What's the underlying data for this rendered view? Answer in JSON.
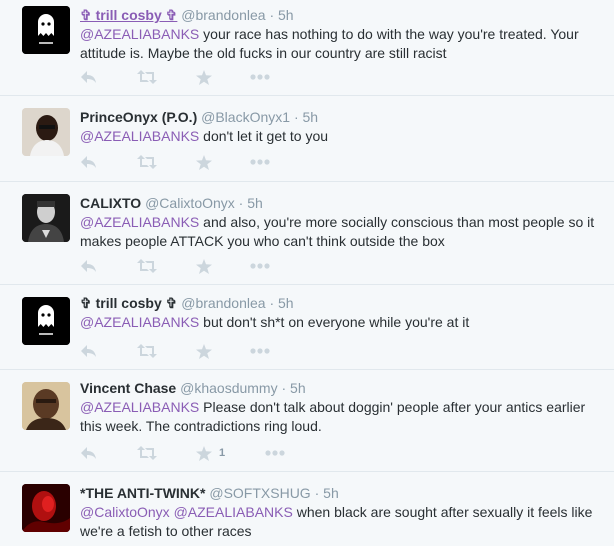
{
  "tweets": [
    {
      "name": "✞ trill cosby ✞",
      "name_link": true,
      "handle": "@brandonlea",
      "time": "5h",
      "text": [
        {
          "t": "@AZEALIABANKS",
          "m": true
        },
        {
          "t": " your race has nothing to do with the way you're treated. Your attitude is. Maybe the old fucks in our country are still racist",
          "m": false
        }
      ],
      "avatar": "ghost-avatar"
    },
    {
      "name": "PrinceOnyx (P.O.)",
      "name_link": false,
      "handle": "@BlackOnyx1",
      "time": "5h",
      "text": [
        {
          "t": "@AZEALIABANKS",
          "m": true
        },
        {
          "t": " don't let it get to you",
          "m": false
        }
      ],
      "avatar": "person-avatar"
    },
    {
      "name": "CALIXTO",
      "name_link": false,
      "handle": "@CalixtoOnyx",
      "time": "5h",
      "text": [
        {
          "t": "@AZEALIABANKS",
          "m": true
        },
        {
          "t": " and also, you're more socially conscious than most people so it makes people ATTACK you who can't think outside the box",
          "m": false
        }
      ],
      "avatar": "person-bw-avatar"
    },
    {
      "name": "✞ trill cosby ✞",
      "name_link": false,
      "handle": "@brandonlea",
      "time": "5h",
      "text": [
        {
          "t": "@AZEALIABANKS",
          "m": true
        },
        {
          "t": " but don't sh*t on everyone while you're at it",
          "m": false
        }
      ],
      "avatar": "ghost-avatar"
    },
    {
      "name": "Vincent Chase",
      "name_link": false,
      "handle": "@khaosdummy",
      "time": "5h",
      "text": [
        {
          "t": "@AZEALIABANKS",
          "m": true
        },
        {
          "t": " Please don't talk about doggin' people after your antics earlier this week. The contradictions ring loud.",
          "m": false
        }
      ],
      "avatar": "person-avatar-2",
      "favorite_count": "1"
    },
    {
      "name": "*THE ANTI-TWINK*",
      "name_link": false,
      "handle": "@SOFTXSHUG",
      "time": "5h",
      "text": [
        {
          "t": "@CalixtoOnyx",
          "m": true
        },
        {
          "t": " ",
          "m": false
        },
        {
          "t": "@AZEALIABANKS",
          "m": true
        },
        {
          "t": " when black are sought after sexually it feels like we're a fetish to other races",
          "m": false
        }
      ],
      "avatar": "red-avatar"
    }
  ],
  "actions": {
    "reply_icon": "reply-icon",
    "retweet_icon": "retweet-icon",
    "favorite_icon": "star-icon",
    "more_icon": "more-icon"
  },
  "colors": {
    "background": "#f5f8fa",
    "link": "#8a5db5",
    "muted": "#8899a6",
    "icon": "#ccd6dd",
    "divider": "#e1e8ed"
  }
}
